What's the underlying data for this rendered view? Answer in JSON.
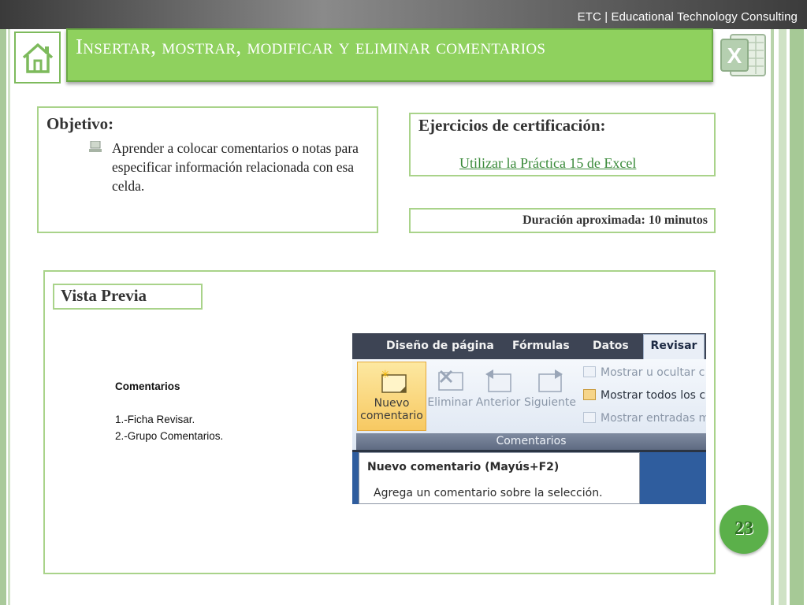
{
  "header": {
    "brand": "ETC | Educational Technology Consulting",
    "title": "Insertar, mostrar, modificar y eliminar comentarios"
  },
  "icons": {
    "home": "home-icon",
    "excel": "excel-logo-icon",
    "bullet": "computer-bullet-icon"
  },
  "objetivo": {
    "title": "Objetivo:",
    "text": "Aprender a colocar comentarios o notas para especificar información relacionada con esa celda."
  },
  "ejercicios": {
    "title": "Ejercicios de  certificación:",
    "link": "Utilizar la Práctica 15 de Excel"
  },
  "duracion": {
    "text": "Duración aproximada:   10 minutos"
  },
  "vista": {
    "label": "Vista Previa",
    "comentarios_title": "Comentarios",
    "steps": [
      "1.-Ficha Revisar.",
      "2.-Grupo Comentarios."
    ]
  },
  "ribbon": {
    "tabs": [
      "Diseño de página",
      "Fórmulas",
      "Datos"
    ],
    "active_tab": "Revisar",
    "buttons": [
      {
        "label": "Nuevo comentario",
        "highlighted": true
      },
      {
        "label": "Eliminar",
        "highlighted": false
      },
      {
        "label": "Anterior",
        "highlighted": false
      },
      {
        "label": "Siguiente",
        "highlighted": false
      }
    ],
    "small_commands": [
      "Mostrar u ocultar c",
      "Mostrar todos los c",
      "Mostrar entradas m"
    ],
    "group_label": "Comentarios",
    "tooltip_title": "Nuevo comentario (Mayús+F2)",
    "tooltip_desc": "Agrega un comentario sobre la selección."
  },
  "page_number": "23",
  "colors": {
    "title_bar": "#8fd15e",
    "box_border": "#a9d38a",
    "link": "#3a8a3a",
    "page_circle": "#5bb04a"
  }
}
